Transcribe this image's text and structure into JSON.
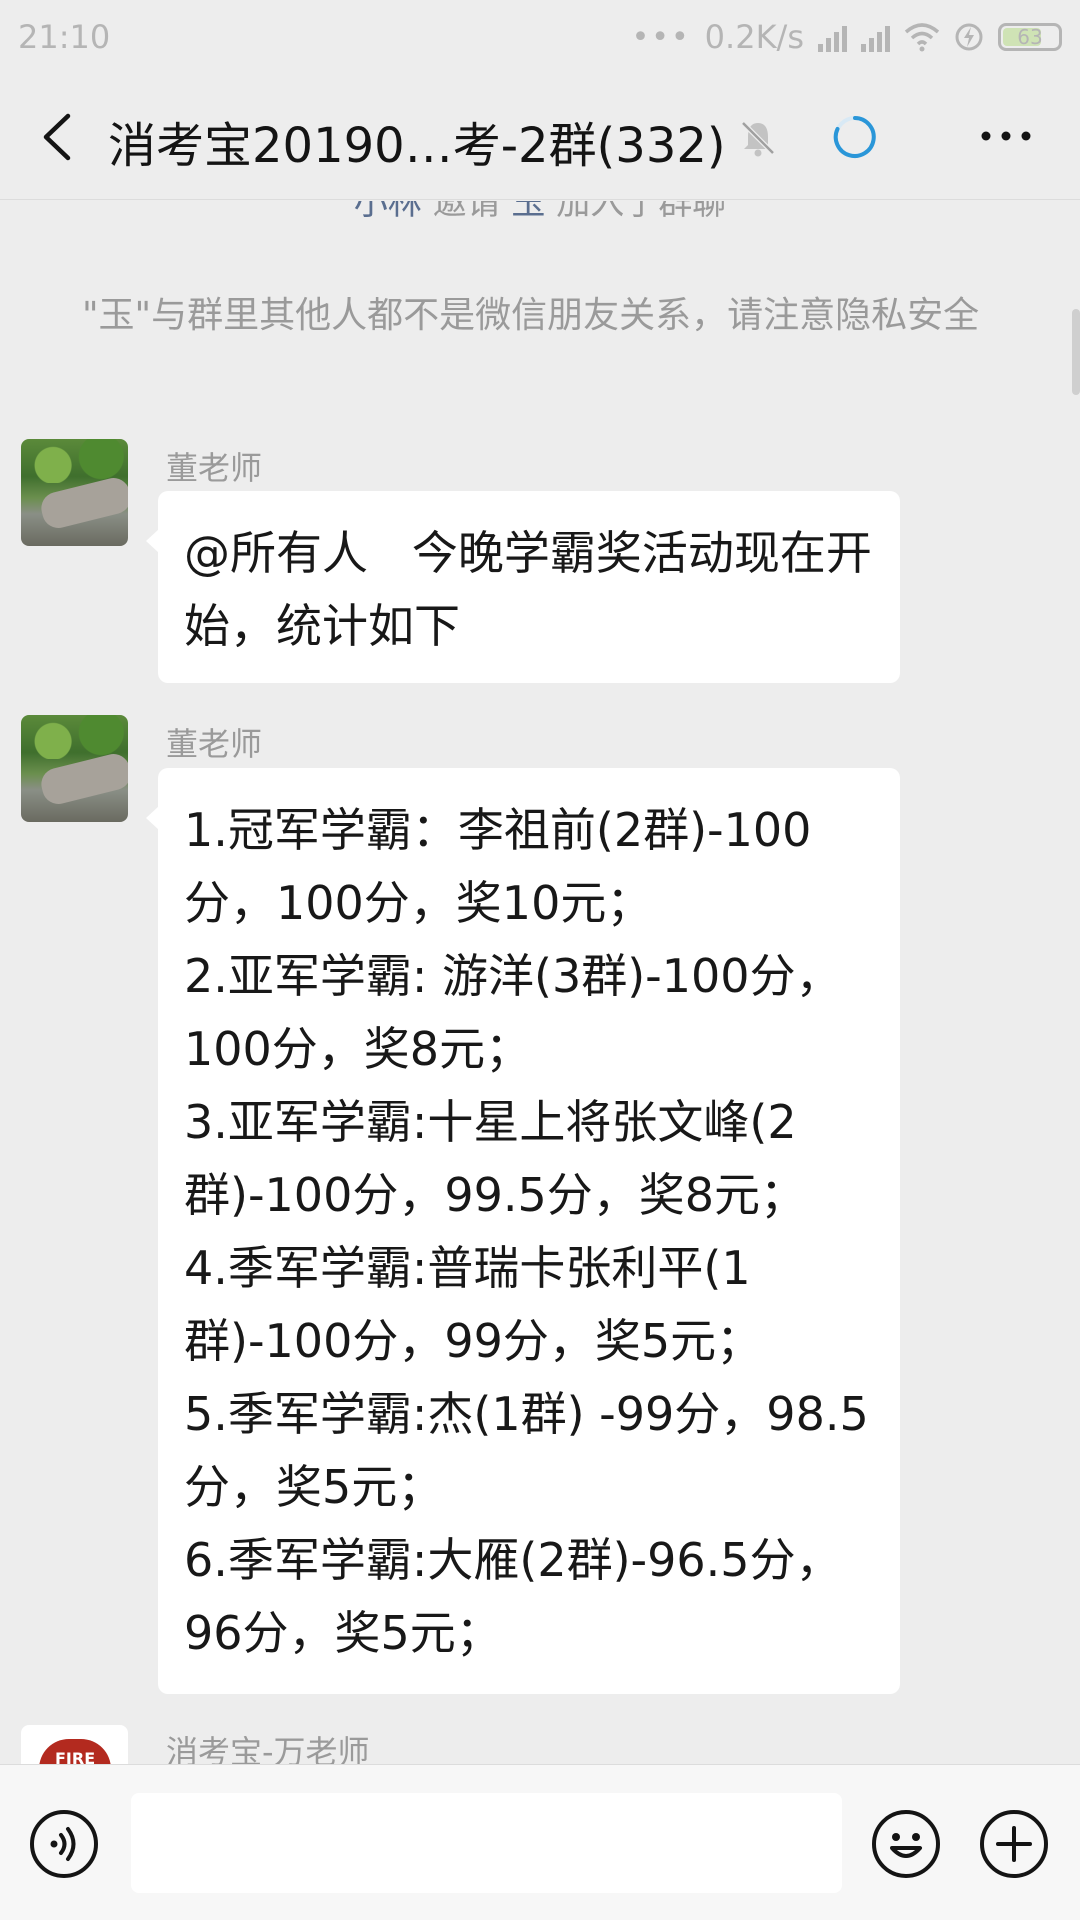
{
  "status_bar": {
    "time": "21:10",
    "dots": "•••",
    "network_speed": "0.2K/s",
    "battery_level": "63",
    "icons": [
      "signal-icon",
      "signal-icon",
      "wifi-icon",
      "charging-icon",
      "battery-icon"
    ]
  },
  "header": {
    "title": "消考宝20190…考-2群(332)",
    "icons": [
      "back-icon",
      "mute-bell-icon",
      "loading-icon",
      "more-icon"
    ]
  },
  "chat": {
    "system_clipped": {
      "inviter": "小林",
      "verb": " 邀请 ",
      "invitee": "玉",
      "rest": " 加入了群聊"
    },
    "system_notice": "\"玉\"与群里其他人都不是微信朋友关系，请注意隐私安全",
    "messages": [
      {
        "sender": "董老师",
        "text": "@所有人   今晚学霸奖活动现在开始，统计如下"
      },
      {
        "sender": "董老师",
        "text": "1.冠军学霸：李祖前(2群)-100分，100分，奖10元；\n2.亚军学霸: 游洋(3群)-100分，100分，奖8元；\n3.亚军学霸:十星上将张文峰(2群)-100分，99.5分，奖8元；\n4.季军学霸:普瑞卡张利平(1群)-100分，99分，奖5元；\n5.季军学霸:杰(1群) -99分，98.5分，奖5元；\n6.季军学霸:大雁(2群)-96.5分，96分，奖5元；"
      },
      {
        "sender": "消考宝-万老师",
        "avatar_text": "FIRE"
      }
    ]
  },
  "input_bar": {
    "placeholder": "",
    "icons": [
      "voice-icon",
      "emoji-icon",
      "add-icon"
    ]
  }
}
